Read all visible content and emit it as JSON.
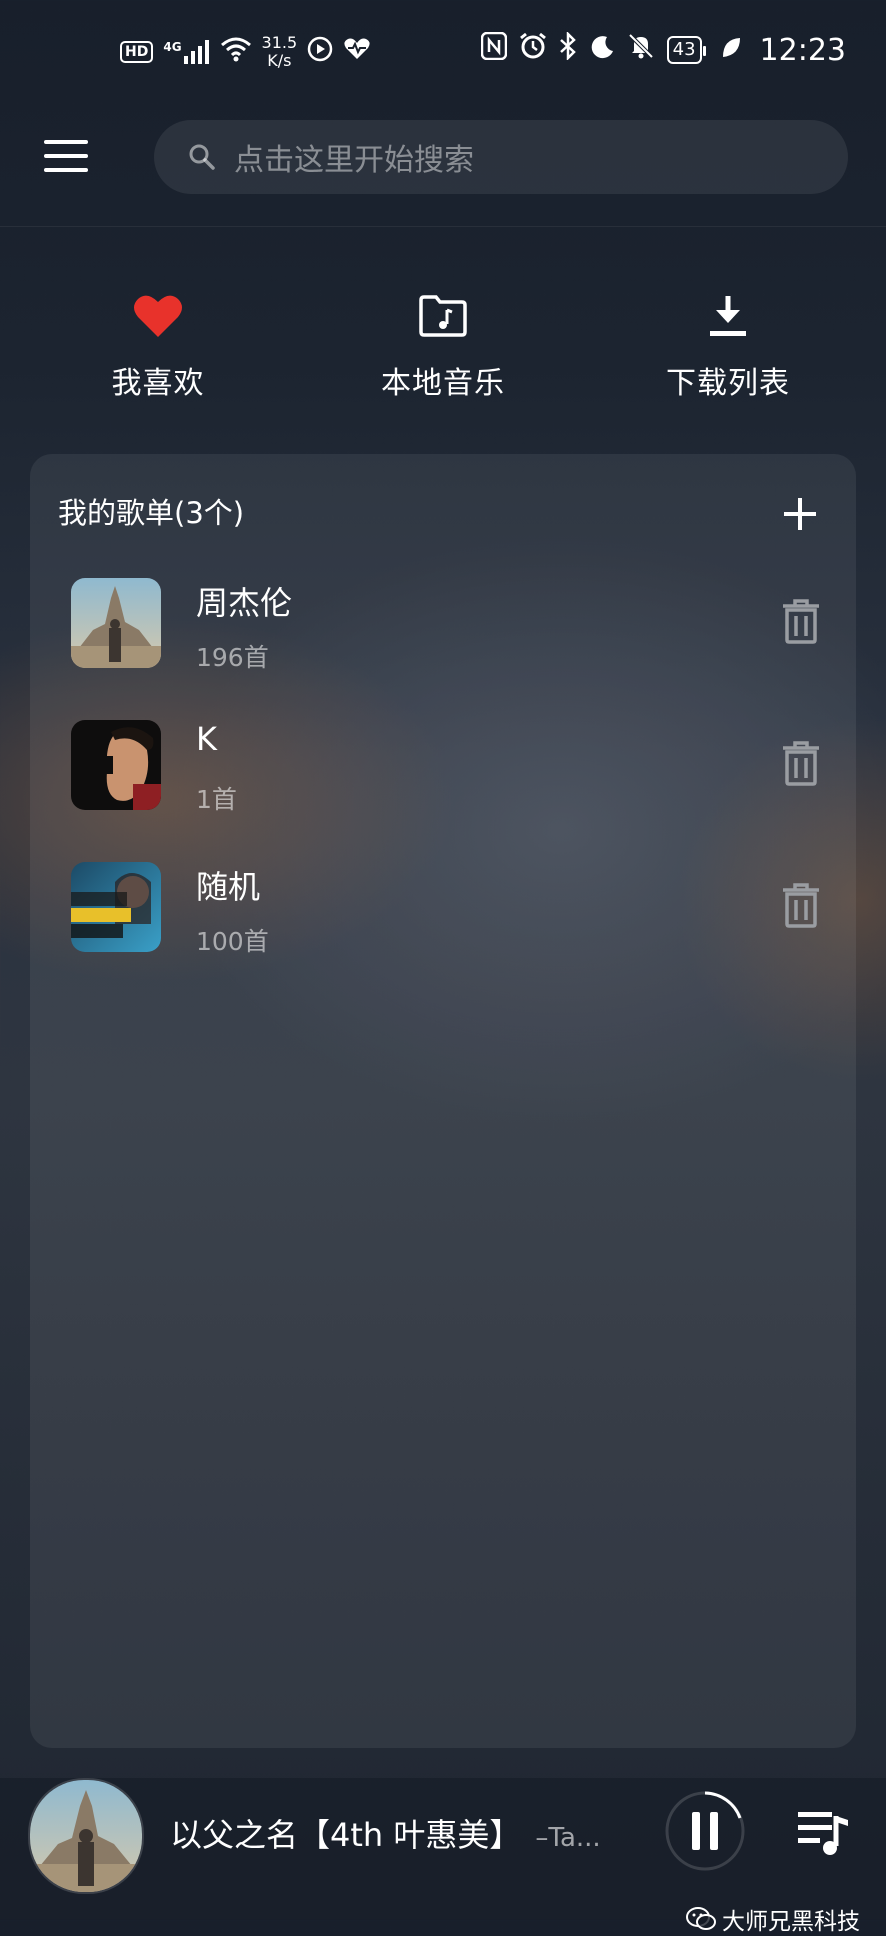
{
  "status_bar": {
    "hd_badge": "HD",
    "network_type": "4G",
    "net_speed_value": "31.5",
    "net_speed_unit": "K/s",
    "battery_level": "43",
    "time": "12:23"
  },
  "header": {
    "menu_icon": "hamburger-menu-icon",
    "search_placeholder": "点击这里开始搜索"
  },
  "quick_actions": [
    {
      "label": "我喜欢",
      "icon": "heart-icon",
      "color": "#e8322b"
    },
    {
      "label": "本地音乐",
      "icon": "music-folder-icon"
    },
    {
      "label": "下载列表",
      "icon": "download-icon"
    }
  ],
  "playlists": {
    "title": "我的歌单(3个)",
    "items": [
      {
        "name": "周杰伦",
        "count": "196首"
      },
      {
        "name": "K",
        "count": "1首"
      },
      {
        "name": "随机",
        "count": "100首"
      }
    ]
  },
  "player": {
    "title": "以父之名【4th 叶惠美】",
    "artist": "–Ta..."
  },
  "watermark": {
    "text": "大师兄黑科技"
  }
}
